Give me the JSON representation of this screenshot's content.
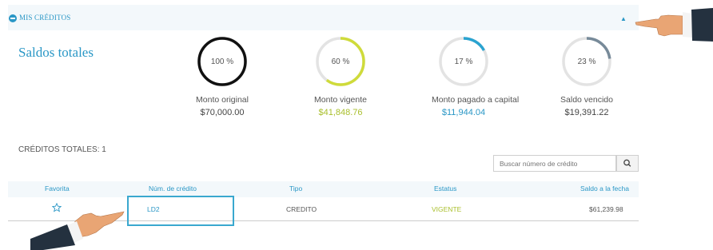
{
  "header": {
    "title": "MIS CRÉDITOS",
    "icon": "minus-circle-icon",
    "collapse_icon": "triangle-up-icon"
  },
  "summary": {
    "title": "Saldos totales",
    "gauges": [
      {
        "percent_label": "100 %",
        "percent": 100,
        "color": "#111111",
        "label": "Monto original",
        "amount": "$70,000.00",
        "amount_color": "#444444"
      },
      {
        "percent_label": "60 %",
        "percent": 60,
        "color": "#cfdb3a",
        "label": "Monto vigente",
        "amount": "$41,848.76",
        "amount_color": "#a9bf2c"
      },
      {
        "percent_label": "17 %",
        "percent": 17,
        "color": "#2aa3d0",
        "label": "Monto pagado a capital",
        "amount": "$11,944.04",
        "amount_color": "#2a97c6"
      },
      {
        "percent_label": "23 %",
        "percent": 23,
        "color": "#778a99",
        "label": "Saldo vencido",
        "amount": "$19,391.22",
        "amount_color": "#444444"
      }
    ]
  },
  "credits": {
    "total_label": "CRÉDITOS TOTALES: 1",
    "search_placeholder": "Buscar número de crédito",
    "search_icon": "search-icon",
    "columns": [
      "Favorita",
      "Núm. de crédito",
      "Tipo",
      "Estatus",
      "Saldo a la fecha"
    ],
    "rows": [
      {
        "favorite_icon": "star-outline-icon",
        "number": "LD2",
        "type": "CREDITO",
        "status": "VIGENTE",
        "balance": "$61,239.98"
      }
    ]
  },
  "colors": {
    "accent": "#2a97c6",
    "status_active": "#a9bf2c",
    "highlight_box": "#3aa8cf",
    "skin": "#e9a574",
    "sleeve": "#24313f"
  }
}
